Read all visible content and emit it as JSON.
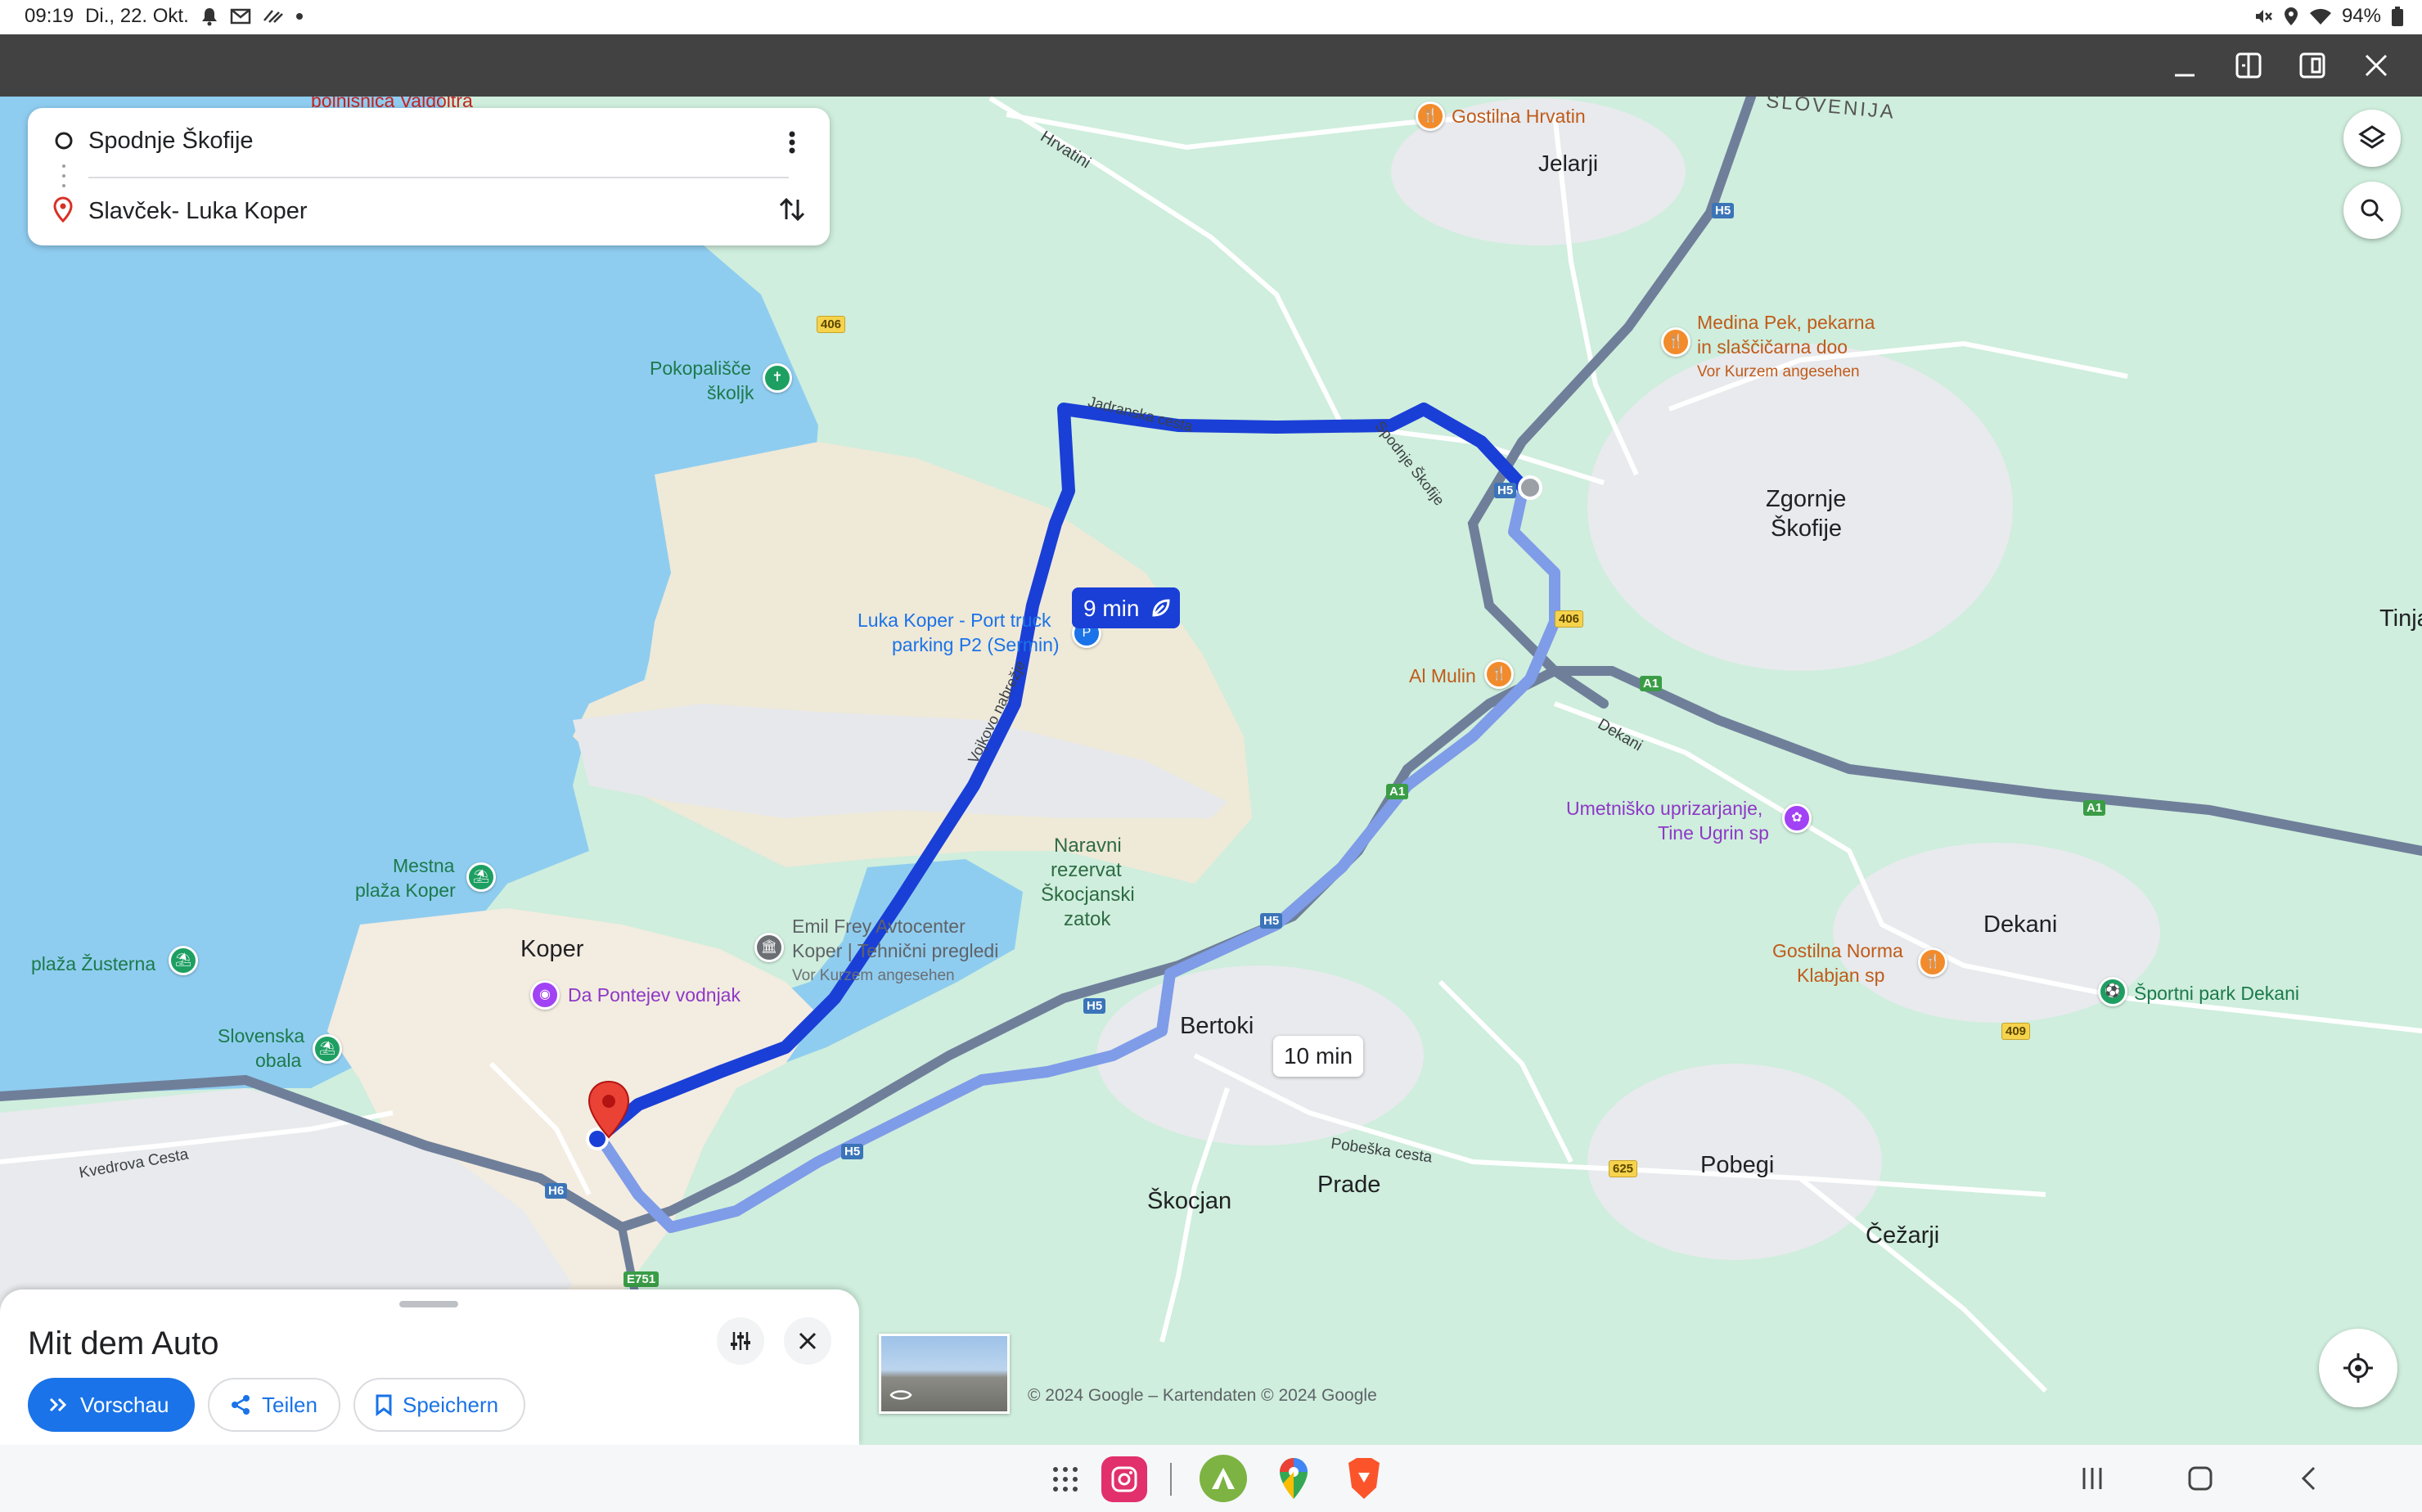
{
  "status_bar": {
    "time": "09:19",
    "date": "Di., 22. Okt.",
    "battery": "94%",
    "left_icons": [
      "bell-icon",
      "gmail-icon",
      "sync-icon",
      "dot-icon"
    ],
    "right_icons": [
      "mute-icon",
      "location-icon",
      "wifi-icon",
      "battery-icon"
    ]
  },
  "window_bar": {
    "buttons": [
      "minimize-icon",
      "split-view-icon",
      "popup-view-icon",
      "close-icon"
    ]
  },
  "route": {
    "origin": "Spodnje Škofije",
    "destination": "Slavček- Luka Koper",
    "primary_time": "9 min",
    "alternative_time": "10 min"
  },
  "map": {
    "cut_label": "bolnišnica Valdoltra",
    "places": {
      "slovenija": "SLOVENIJA",
      "jelarji": "Jelarji",
      "hrvatini": "Hrvatini",
      "zgornje_1": "Zgornje",
      "zgornje_2": "Škofije",
      "tinja": "Tinja",
      "koper": "Koper",
      "bertoki": "Bertoki",
      "dekani": "Dekani",
      "pobegi": "Pobegi",
      "skocjan": "Škocjan",
      "prade": "Prade",
      "cezarji": "Čežarji",
      "naravni_1": "Naravni",
      "naravni_2": "rezervat",
      "naravni_3": "Škocjanski",
      "naravni_4": "zatok"
    },
    "streets": {
      "jadranska": "Jadranska cesta",
      "spodnje_skofije": "Spodnje Škofije",
      "vojkova": "Vojkovo nabrežje",
      "dekani_rd": "Dekani",
      "kvedrova": "Kvedrova Cesta",
      "pobeska": "Pobeška cesta"
    },
    "pois": {
      "gostilna_hrvatin": "Gostilna Hrvatin",
      "medina_1": "Medina Pek, pekarna",
      "medina_2": "in slaščičarna doo",
      "medina_note": "Vor Kurzem angesehen",
      "pokopalisce_1": "Pokopališče",
      "pokopalisce_2": "školjk",
      "luka_1": "Luka Koper - Port truck",
      "luka_2": "parking P2 (Sermin)",
      "al_mulin": "Al Mulin",
      "umetnisko_1": "Umetniško uprizarjanje,",
      "umetnisko_2": "Tine Ugrin sp",
      "mestna_1": "Mestna",
      "mestna_2": "plaža Koper",
      "zusterna": "plaža Žusterna",
      "slovenska_1": "Slovenska",
      "slovenska_2": "obala",
      "emil_1": "Emil Frey Avtocenter",
      "emil_2": "Koper | Tehnični pregledi",
      "emil_note": "Vor Kurzem angesehen",
      "pontejev": "Da Pontejev vodnjak",
      "gostilna_norma_1": "Gostilna Norma",
      "gostilna_norma_2": "Klabjan sp",
      "sportni_park": "Športni park Dekani"
    },
    "road_shields": {
      "r406a": "406",
      "r406b": "406",
      "r409": "409",
      "r625": "625",
      "h5a": "H5",
      "h5b": "H5",
      "h5c": "H5",
      "h5d": "H5",
      "h5e": "H5",
      "h6": "H6",
      "a1a": "A1",
      "a1b": "A1",
      "a1c": "A1",
      "e751": "E751"
    },
    "copyright": "© 2024 Google – Kartendaten © 2024 Google"
  },
  "sheet": {
    "title": "Mit dem Auto",
    "preview": "Vorschau",
    "share": "Teilen",
    "save": "Speichern"
  },
  "colors": {
    "route_primary": "#1a3fd6",
    "route_alt": "#7f9ce8",
    "accent": "#1a73e8",
    "map_green": "#cfeedd",
    "water": "#8fcdf0"
  },
  "navbar": {
    "apps": [
      "app-drawer-icon",
      "instagram-icon",
      "camping-app-icon",
      "google-maps-icon",
      "brave-browser-icon"
    ],
    "buttons": [
      "recents-icon",
      "home-icon",
      "back-icon"
    ]
  }
}
